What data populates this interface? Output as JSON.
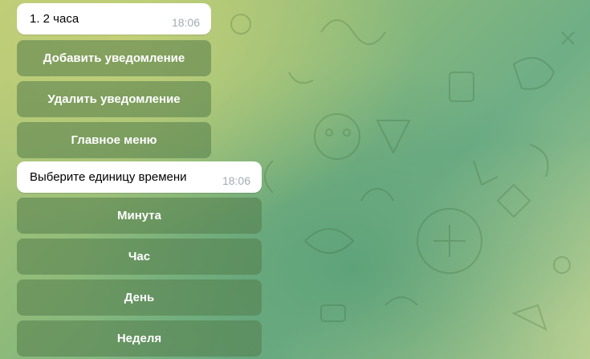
{
  "messages": [
    {
      "text": "1. 2 часа",
      "time": "18:06"
    },
    {
      "text": "Выберите единицу времени",
      "time": "18:06"
    }
  ],
  "keyboard1": {
    "add": "Добавить уведомление",
    "delete": "Удалить уведомление",
    "main": "Главное меню"
  },
  "keyboard2": {
    "minute": "Минута",
    "hour": "Час",
    "day": "День",
    "week": "Неделя"
  },
  "colors": {
    "bubble": "#ffffff",
    "time": "#a3acb3",
    "button": "#547c4a",
    "button_text": "#ffffff"
  },
  "icons": [
    "doodle-pattern"
  ]
}
